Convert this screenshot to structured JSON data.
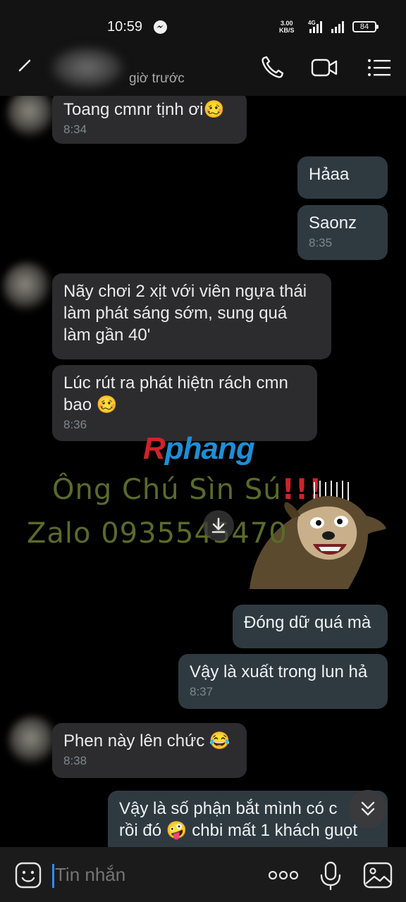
{
  "status_bar": {
    "time": "10:59",
    "speed_value": "3.00",
    "speed_unit": "KB/S",
    "network": "4G",
    "battery": "84"
  },
  "header": {
    "last_seen": "giờ trước",
    "icons": [
      "back-arrow-icon",
      "phone-icon",
      "video-call-icon",
      "menu-list-icon"
    ]
  },
  "messages": [
    {
      "dir": "in",
      "text": "Toang cmnr tịnh ơi🥴",
      "time": "8:34"
    },
    {
      "dir": "out",
      "text": "Hảaa",
      "time": ""
    },
    {
      "dir": "out",
      "text": "Saonz",
      "time": "8:35"
    },
    {
      "dir": "in",
      "text": "Nãy chơi 2 xịt với viên ngựa thái\nlàm phát sáng sớm, sung quá\nlàm gần 40'",
      "time": ""
    },
    {
      "dir": "in",
      "text": "Lúc rút ra phát hiệtn rách cmn\nbao 🥴",
      "time": "8:36"
    },
    {
      "dir": "out",
      "text": "Đóng dữ quá mà",
      "time": ""
    },
    {
      "dir": "out",
      "text": "Vậy là xuất trong lun hả",
      "time": "8:37"
    },
    {
      "dir": "in",
      "text": "Phen này lên chức 😂",
      "time": "8:38"
    },
    {
      "dir": "out",
      "text": "Vậy là số phận bắt mình có c\nrồi đó 🤪 chbi mất 1 khách guọt",
      "time": ""
    }
  ],
  "watermark": {
    "logo_r": "R",
    "logo_rest": "phang",
    "line1": "Ông Chú Sìn Sú",
    "exclaim": "!!!",
    "line2": "Zalo 0935545470"
  },
  "composer": {
    "placeholder": "Tin nhắn"
  },
  "colors": {
    "bubble_in": "#2c2c2e",
    "bubble_out": "#2f3a40",
    "background": "#000000",
    "accent": "#2f8cff"
  }
}
